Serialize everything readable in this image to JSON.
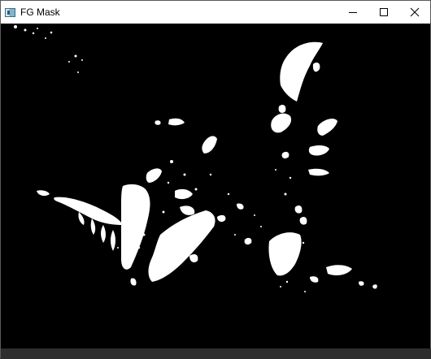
{
  "window": {
    "title": "FG Mask",
    "app_icon": "window-app-icon",
    "controls": [
      {
        "name": "minimize-button",
        "icon": "minimize-icon"
      },
      {
        "name": "maximize-button",
        "icon": "maximize-icon"
      },
      {
        "name": "close-button",
        "icon": "close-icon"
      }
    ]
  },
  "content": {
    "type": "binary-foreground-mask",
    "background_color": "#000000",
    "foreground_color": "#ffffff"
  }
}
